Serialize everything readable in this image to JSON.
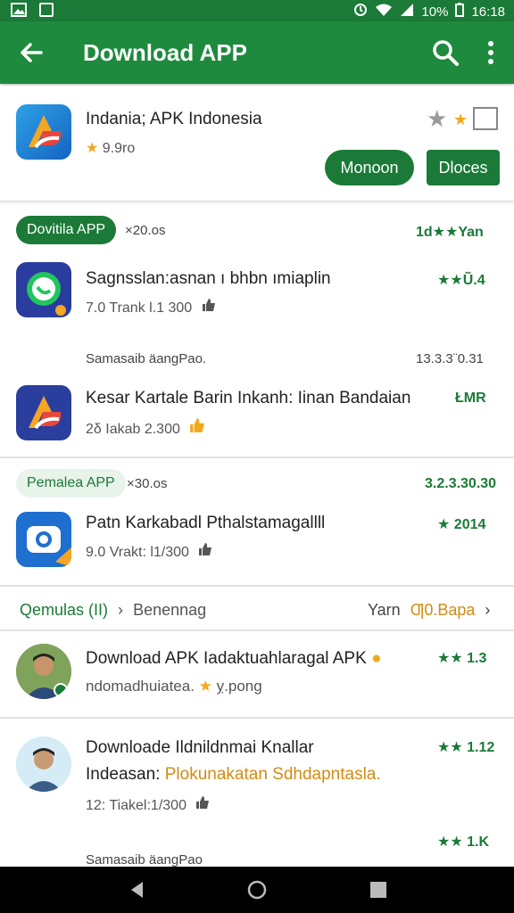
{
  "status_bar": {
    "left_icons": [
      "image-icon",
      "square-icon"
    ],
    "battery": "10%",
    "time": "16:18"
  },
  "app_bar": {
    "title": "Download APP"
  },
  "top_app": {
    "name": "Indania; APK Indonesia",
    "rating": "9.9ro",
    "button_primary": "Monoon",
    "button_secondary": "Dloces"
  },
  "section1": {
    "chip": "Dovitila APP",
    "chip_meta": "×20.os",
    "right_meta": "1d★★Yan",
    "items": [
      {
        "name": "Sagnsslan:asnan ı bhbn ımiaplin",
        "rating": "★★Ũ.4",
        "sub": "7.0 Trank l.1 300",
        "footer_left": "Samasaib äangPao.",
        "footer_right": "13.3.3¨0.31"
      },
      {
        "name": "Kesar Kartale Barin Inkanh: Iinan Bandaian",
        "rating": "ŁMR",
        "sub": "2δ Iakab 2.300"
      }
    ]
  },
  "section2": {
    "chip": "Pemalea APP",
    "chip_meta": "×30.os",
    "right_meta": "3.2.3.30.30",
    "items": [
      {
        "name": "Patn Karkabadl Pthalstamagallll",
        "rating": "★ 2014",
        "sub": "9.0 Vrakt: l1/300"
      }
    ]
  },
  "section3": {
    "left_label": "Qemulas (II)",
    "breadcrumb_sep": "›",
    "breadcrumb_item": "Benennag",
    "right_label": "Yarn",
    "right_link": "Ƣ0.Bapa",
    "items": [
      {
        "name": "Download APK Iadaktuahlaragal APK",
        "rating": "★★ 1.3",
        "sub_a": "ndomadhuiatea.",
        "sub_b": "ỵ.pong"
      },
      {
        "name": "Downloade Ildnildnmai Knallar",
        "name2_prefix": "Indeasan:",
        "name2_highlight": "Plokunakatan Sdhdapntasla.",
        "rating": "★★ 1.12",
        "sub": "12: Tiakel:1/300"
      }
    ],
    "footer_rating": "★★ 1.K",
    "footer_text": "Samasaib äangPao"
  },
  "icons": {
    "back": "arrow-left-icon",
    "search": "search-icon",
    "more": "more-vert-icon",
    "thumb": "thumb-up-icon",
    "nav_back": "triangle-back-icon",
    "nav_home": "circle-home-icon",
    "nav_recent": "square-recent-icon"
  },
  "colors": {
    "brand": "#1e8a3d",
    "brand_dark": "#1b7a37",
    "accent_gold": "#f2a81d"
  }
}
